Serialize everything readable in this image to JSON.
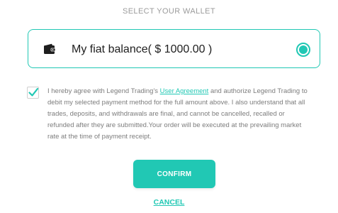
{
  "wallet_section": {
    "title": "SELECT YOUR WALLET",
    "option": {
      "label": "My fiat balance( $ 1000.00 )",
      "icon": "wallet-icon",
      "selected": true
    }
  },
  "agreement": {
    "checked": true,
    "text_before": "I hereby agree with Legend Trading's ",
    "link_text": "User Agreement",
    "text_after": " and authorize Legend Trading to debit my selected payment method for the full amount above. I also understand that all trades, deposits, and withdrawals are final, and cannot be cancelled, recalled or refunded after they are submitted.Your order will be executed at the prevailing market rate at the time of payment receipt."
  },
  "actions": {
    "confirm_label": "CONFIRM",
    "cancel_label": "CANCEL"
  },
  "colors": {
    "accent": "#21c8b4",
    "text_muted": "#7d7d7d",
    "title_gray": "#9b9b9b"
  }
}
